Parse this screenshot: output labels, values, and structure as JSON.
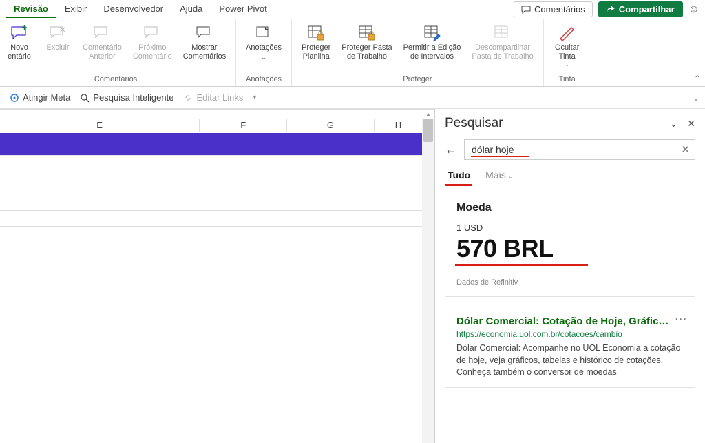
{
  "tabs": {
    "revisao": "Revisão",
    "exibir": "Exibir",
    "desenvolvedor": "Desenvolvedor",
    "ajuda": "Ajuda",
    "powerpivot": "Power Pivot"
  },
  "topRight": {
    "comments": "Comentários",
    "share": "Compartilhar"
  },
  "ribbon": {
    "novo_comentario": "Novo\nentário",
    "excluir": "Excluir",
    "comentario_anterior": "Comentário\nAnterior",
    "proximo_comentario": "Próximo\nComentário",
    "mostrar_comentarios": "Mostrar\nComentários",
    "anotacoes": "Anotações",
    "proteger_planilha": "Proteger\nPlanilha",
    "proteger_pasta": "Proteger Pasta\nde Trabalho",
    "permitir_edicao": "Permitir a Edição\nde Intervalos",
    "descompartilhar": "Descompartilhar\nPasta de Trabalho",
    "ocultar_tinta": "Ocultar\nTinta",
    "group_comentarios": "Comentários",
    "group_anotacoes": "Anotações",
    "group_proteger": "Proteger",
    "group_tinta": "Tinta"
  },
  "quickbar": {
    "atingir_meta": "Atingir Meta",
    "pesquisa_inteligente": "Pesquisa Inteligente",
    "editar_links": "Editar Links"
  },
  "columns": {
    "e": "E",
    "f": "F",
    "g": "G",
    "h": "H"
  },
  "searchPane": {
    "title": "Pesquisar",
    "query": "dólar hoje",
    "tab_tudo": "Tudo",
    "tab_mais": "Mais",
    "card": {
      "title": "Moeda",
      "equals": "1 USD =",
      "rate": "570 BRL",
      "source": "Dados de Refinitiv"
    },
    "result": {
      "title": "Dólar Comercial: Cotação de Hoje, Gráficos e ta…",
      "url": "https://economia.uol.com.br/cotacoes/cambio",
      "desc": "Dólar Comercial: Acompanhe no UOL Economia a cotação de hoje, veja gráficos, tabelas e histórico de cotações. Conheça também o conversor de moedas"
    }
  }
}
